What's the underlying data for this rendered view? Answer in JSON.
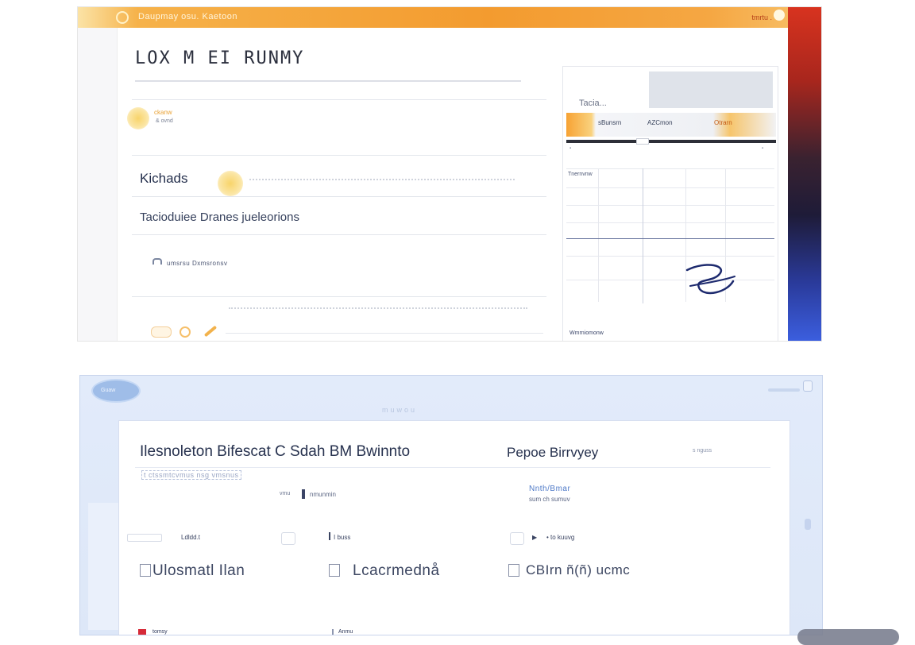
{
  "top_window": {
    "titlebar": {
      "title": "Daupmay  osu. Kaetoon",
      "right_text": "tmrtu ."
    },
    "heading": "LOX M EI RUNMY",
    "badge": {
      "title": "ckanw",
      "subtitle": "& ovnd"
    },
    "row1": {
      "label": "Kichads"
    },
    "row2": {
      "label": "Tacioduiee Dranes jueleorions"
    },
    "row3": {
      "label": "umsrsu Dxmsronsv"
    },
    "panel": {
      "label": "Tacia...",
      "bar_left": "sBunsrn",
      "bar_mid": "AZCmon",
      "bar_right": "Otrarn",
      "grid_corner": "Tnernvnw",
      "footer": "Wmrniomonw"
    }
  },
  "bottom_window": {
    "oval_label": "Guaw",
    "top_center": "muwou",
    "title_left": "Ilesnoleton Bifescat  C  Sdah BM Bwinnto",
    "title_right": "Pepoe Birrvyey",
    "title_hint": "s nguss",
    "link_box": "t ctssmtcvmus nsg vmsnus",
    "meta_text": "nmunmin",
    "meta_prefix": "vmu",
    "info_link": "Nnth/Bmar",
    "info_sub": "sum ch sumuv",
    "group1": "Ldldd.t",
    "group2": "I buss",
    "group3": "• to kuuvg",
    "checks": [
      {
        "label": "Ulosmatl Ilan"
      },
      {
        "label": "Lcacrmednå"
      },
      {
        "label": "CBIrn ñ(ñ) ucmc"
      }
    ],
    "footer_left": "tomsy",
    "footer_mid": "Anmu"
  },
  "accent_colors": {
    "orange": "#f39b2f",
    "red": "#d8331f",
    "navy": "#1e1b38",
    "blue": "#3c5fe0",
    "light_blue": "#dde7f8"
  }
}
